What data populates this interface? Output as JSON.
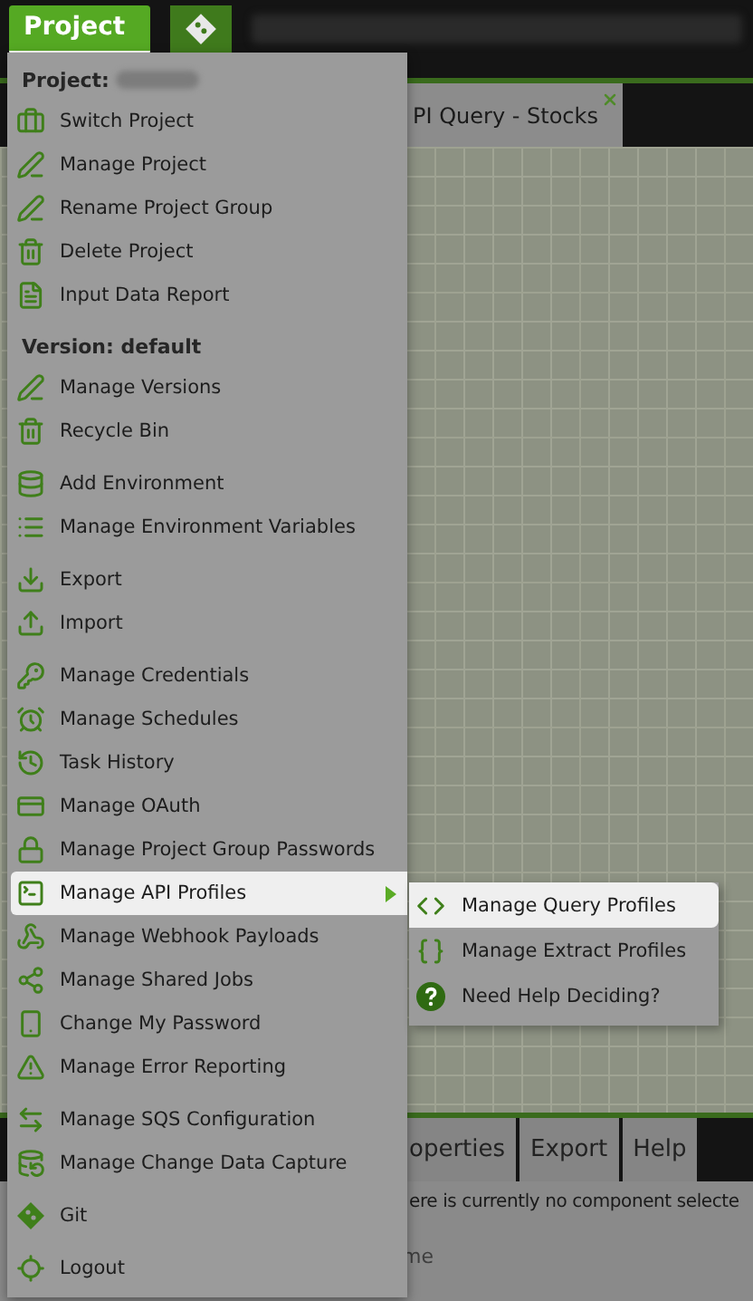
{
  "top_bar": {
    "project_button": "Project"
  },
  "editor_tab": {
    "label": "PI Query - Stocks"
  },
  "menu": {
    "groups": [
      {
        "header": "Project:",
        "redacted_name": true,
        "items": [
          {
            "label": "Switch Project",
            "kind": "briefcase",
            "selected": false,
            "submenu": false
          },
          {
            "label": "Manage Project",
            "kind": "pen",
            "selected": false,
            "submenu": false
          },
          {
            "label": "Rename Project Group",
            "kind": "pen",
            "selected": false,
            "submenu": false
          },
          {
            "label": "Delete Project",
            "kind": "trash",
            "selected": false,
            "submenu": false
          },
          {
            "label": "Input Data Report",
            "kind": "file",
            "selected": false,
            "submenu": false
          }
        ]
      },
      {
        "header": "Version: default",
        "redacted_name": false,
        "items": [
          {
            "label": "Manage Versions",
            "kind": "pen",
            "selected": false,
            "submenu": false
          },
          {
            "label": "Recycle Bin",
            "kind": "trash",
            "selected": false,
            "submenu": false
          }
        ]
      },
      {
        "items": [
          {
            "label": "Add Environment",
            "kind": "database-plus",
            "selected": false,
            "submenu": false
          },
          {
            "label": "Manage Environment Variables",
            "kind": "list",
            "selected": false,
            "submenu": false
          }
        ]
      },
      {
        "items": [
          {
            "label": "Export",
            "kind": "download",
            "selected": false,
            "submenu": false
          },
          {
            "label": "Import",
            "kind": "upload",
            "selected": false,
            "submenu": false
          }
        ]
      },
      {
        "items": [
          {
            "label": "Manage Credentials",
            "kind": "key",
            "selected": false,
            "submenu": false
          },
          {
            "label": "Manage Schedules",
            "kind": "alarm",
            "selected": false,
            "submenu": false
          },
          {
            "label": "Task History",
            "kind": "history",
            "selected": false,
            "submenu": false
          },
          {
            "label": "Manage OAuth",
            "kind": "card",
            "selected": false,
            "submenu": false
          },
          {
            "label": "Manage Project Group Passwords",
            "kind": "lock",
            "selected": false,
            "submenu": false
          },
          {
            "label": "Manage API Profiles",
            "kind": "terminal",
            "selected": true,
            "submenu": true
          },
          {
            "label": "Manage Webhook Payloads",
            "kind": "webhook",
            "selected": false,
            "submenu": false
          },
          {
            "label": "Manage Shared Jobs",
            "kind": "share",
            "selected": false,
            "submenu": false
          },
          {
            "label": "Change My Password",
            "kind": "phone",
            "selected": false,
            "submenu": false
          },
          {
            "label": "Manage Error Reporting",
            "kind": "warning",
            "selected": false,
            "submenu": false
          }
        ]
      },
      {
        "items": [
          {
            "label": "Manage SQS Configuration",
            "kind": "arrows",
            "selected": false,
            "submenu": false
          },
          {
            "label": "Manage Change Data Capture",
            "kind": "database-arrow",
            "selected": false,
            "submenu": false
          }
        ]
      },
      {
        "items": [
          {
            "label": "Git",
            "kind": "git",
            "selected": false,
            "submenu": false
          }
        ]
      },
      {
        "items": [
          {
            "label": "Logout",
            "kind": "logout",
            "selected": false,
            "submenu": false
          }
        ]
      }
    ]
  },
  "submenu": {
    "items": [
      {
        "label": "Manage Query Profiles",
        "kind": "code",
        "selected": true
      },
      {
        "label": "Manage Extract Profiles",
        "kind": "braces",
        "selected": false
      },
      {
        "label": "Need Help Deciding?",
        "kind": "help",
        "selected": false
      }
    ]
  },
  "bottom_panel": {
    "tabs": [
      "operties",
      "Export",
      "Help"
    ],
    "message": "ere is currently no component selecte",
    "column_1": "me"
  }
}
